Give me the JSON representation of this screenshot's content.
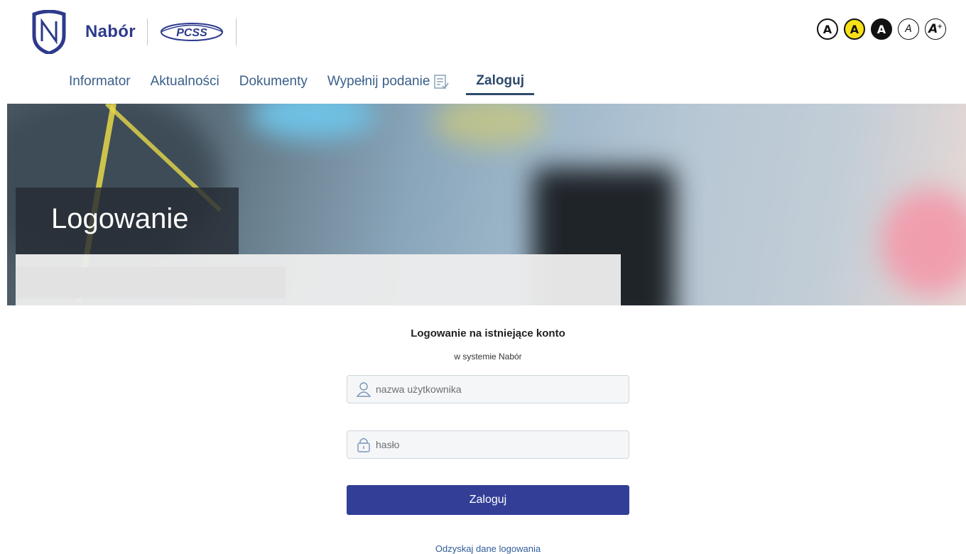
{
  "header": {
    "brand": "Nabór",
    "partner_logo": "PCSS",
    "contrast_buttons": [
      {
        "label": "A",
        "variant": "normal"
      },
      {
        "label": "A",
        "variant": "yellow"
      },
      {
        "label": "A",
        "variant": "dark"
      },
      {
        "label": "A",
        "variant": "small"
      },
      {
        "label": "A",
        "variant": "large",
        "suffix": "+"
      }
    ]
  },
  "nav": {
    "items": [
      {
        "label": "Informator"
      },
      {
        "label": "Aktualności"
      },
      {
        "label": "Dokumenty"
      },
      {
        "label": "Wypełnij podanie",
        "icon": "form-icon"
      },
      {
        "label": "Zaloguj",
        "active": true
      }
    ]
  },
  "banner": {
    "title": "Logowanie"
  },
  "login": {
    "title": "Logowanie na istniejące konto",
    "subtitle": "w systemie Nabór",
    "username_placeholder": "nazwa użytkownika",
    "password_placeholder": "hasło",
    "submit_label": "Zaloguj",
    "recover_link": "Odzyskaj dane logowania"
  },
  "colors": {
    "brand": "#2d3a8c",
    "nav_text": "#3a5f8a",
    "button": "#333f96",
    "link": "#2f5d99",
    "contrast_yellow": "#f7e018"
  }
}
